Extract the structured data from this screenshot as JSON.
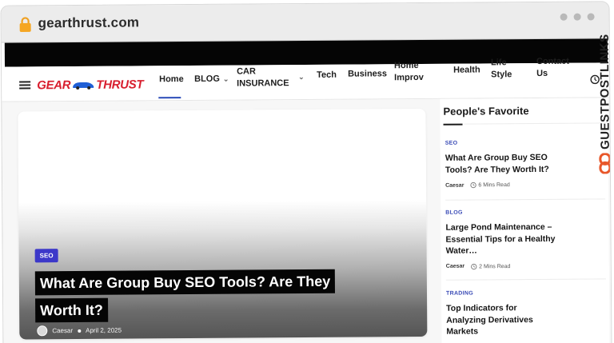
{
  "browser": {
    "domain": "gearthrust.com"
  },
  "site": {
    "logo_part1": "GEAR",
    "logo_part2": "THRUST",
    "brand_color": "#d81e2e",
    "accent_color": "#2a4bb8"
  },
  "nav": {
    "items": [
      {
        "label": "Home",
        "active": true
      },
      {
        "label": "BLOG",
        "has_dropdown": true
      },
      {
        "label_line1": "CAR",
        "label_line2": "INSURANCE",
        "has_dropdown": true
      },
      {
        "label": "Tech"
      },
      {
        "label": "Business"
      },
      {
        "label_line1": "Home",
        "label_line2": "Improv"
      },
      {
        "label": "Health"
      },
      {
        "label_line1": "Life",
        "label_line2": "Style"
      },
      {
        "label_line1": "Contact",
        "label_line2": "Us"
      }
    ],
    "icons": [
      "hamburger-icon",
      "clock-icon",
      "chevron-down-icon"
    ]
  },
  "side_brand": {
    "text": "GUESTPOSTLINKS"
  },
  "hero": {
    "tag": "SEO",
    "title_line1": "What Are Group Buy SEO Tools? Are They",
    "title_line2": "Worth It?",
    "author": "Caesar",
    "date": "April 2, 2025"
  },
  "sidebar": {
    "heading": "People's Favorite",
    "posts": [
      {
        "category": "SEO",
        "title": "What Are Group Buy SEO Tools? Are They Worth It?",
        "author": "Caesar",
        "read_time": "6 Mins Read"
      },
      {
        "category": "BLOG",
        "title": "Large Pond Maintenance – Essential Tips for a Healthy Water…",
        "author": "Caesar",
        "read_time": "2 Mins Read"
      },
      {
        "category": "TRADING",
        "title": "Top Indicators for Analyzing Derivatives Markets",
        "author": "",
        "read_time": ""
      }
    ]
  }
}
